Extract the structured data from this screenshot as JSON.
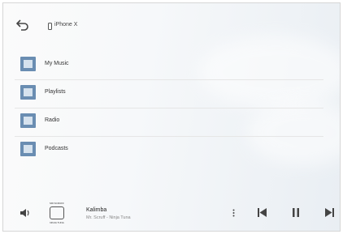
{
  "header": {
    "back_icon": "back-arrow-icon",
    "source_icon": "iphone-icon",
    "source_label": "iPhone X"
  },
  "menu": {
    "items": [
      {
        "label": "My Music",
        "icon": "folder-icon"
      },
      {
        "label": "Playlists",
        "icon": "folder-icon"
      },
      {
        "label": "Radio",
        "icon": "folder-icon"
      },
      {
        "label": "Podcasts",
        "icon": "folder-icon"
      }
    ]
  },
  "player": {
    "track_title": "Kalimba",
    "track_artist": "Mr. Scruff - Ninja Tuna",
    "album_art": "album-art",
    "album_art_text_top": "MR.SCRUFF",
    "album_art_text_bottom": "NINJA TUNA",
    "controls": [
      "volume-icon",
      "more-icon",
      "previous-icon",
      "pause-icon",
      "next-icon"
    ]
  },
  "colors": {
    "folder_icon": "#6a8db2",
    "background": "#f4f6f8",
    "text": "#333333"
  }
}
